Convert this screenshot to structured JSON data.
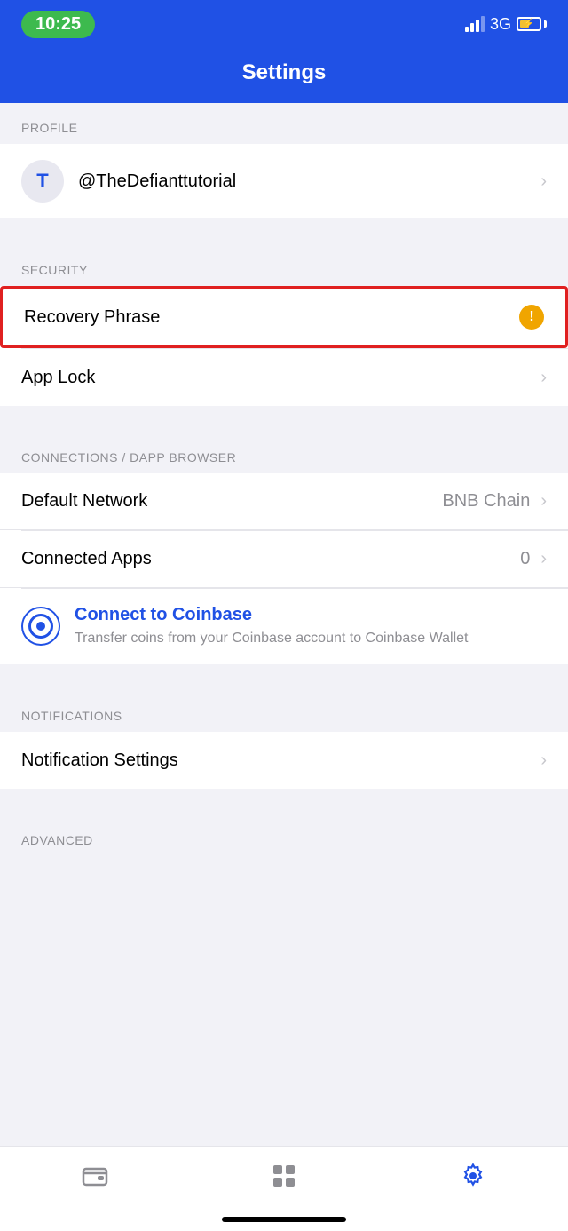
{
  "status": {
    "time": "10:25",
    "network": "3G"
  },
  "header": {
    "title": "Settings"
  },
  "sections": {
    "profile": {
      "label": "PROFILE",
      "items": [
        {
          "id": "profile-account",
          "avatar_letter": "T",
          "name": "@TheDefianttutorial",
          "has_chevron": true
        }
      ]
    },
    "security": {
      "label": "SECURITY",
      "items": [
        {
          "id": "recovery-phrase",
          "name": "Recovery Phrase",
          "has_warning": true,
          "highlighted": true
        },
        {
          "id": "app-lock",
          "name": "App Lock",
          "has_chevron": true
        }
      ]
    },
    "connections": {
      "label": "CONNECTIONS / DAPP BROWSER",
      "items": [
        {
          "id": "default-network",
          "name": "Default Network",
          "value": "BNB Chain",
          "has_chevron": true
        },
        {
          "id": "connected-apps",
          "name": "Connected Apps",
          "value": "0",
          "has_chevron": true
        },
        {
          "id": "coinbase-connect",
          "name": "Connect to Coinbase",
          "subtitle": "Transfer coins from your Coinbase account to Coinbase Wallet",
          "is_coinbase": true
        }
      ]
    },
    "notifications": {
      "label": "NOTIFICATIONS",
      "items": [
        {
          "id": "notification-settings",
          "name": "Notification Settings",
          "has_chevron": true
        }
      ]
    },
    "advanced": {
      "label": "ADVANCED"
    }
  },
  "bottom_nav": {
    "items": [
      {
        "id": "wallet",
        "icon": "wallet",
        "active": false,
        "label": "Wallet"
      },
      {
        "id": "apps",
        "icon": "apps",
        "active": false,
        "label": "Apps"
      },
      {
        "id": "settings",
        "icon": "settings",
        "active": true,
        "label": "Settings"
      }
    ]
  }
}
